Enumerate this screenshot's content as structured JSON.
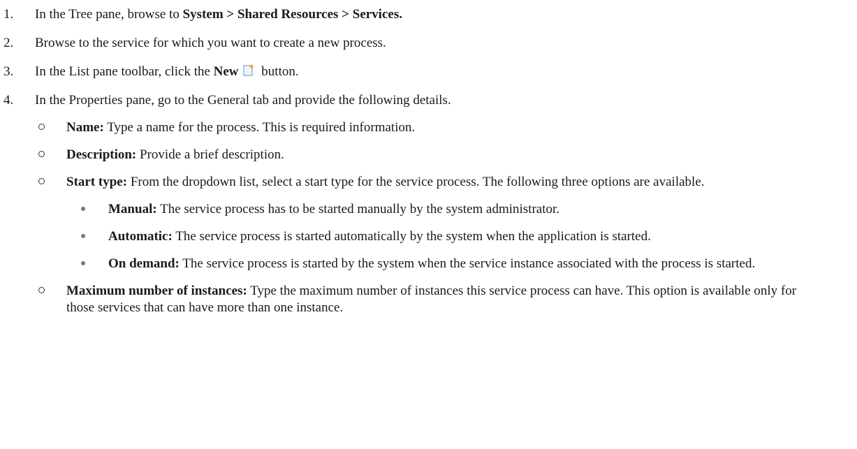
{
  "steps": [
    {
      "number": "1.",
      "text": "In the Tree pane, browse to ",
      "bold": "System > Shared Resources > Services."
    },
    {
      "number": "2.",
      "text": "Browse to the service for which you want to create a new process."
    },
    {
      "number": "3.",
      "text_before": "In the List pane toolbar, click the ",
      "bold": "New",
      "text_after": " button.",
      "icon": "new-document-icon"
    },
    {
      "number": "4.",
      "text": "In the Properties pane, go to the General tab and provide the following details."
    }
  ],
  "details": [
    {
      "term": "Name:",
      "text": " Type a name for the process. This is required information."
    },
    {
      "term": "Description:",
      "text": " Provide a brief description."
    },
    {
      "term": "Start type:",
      "text": " From the dropdown list, select a start type for the service process. The following three options are available."
    },
    {
      "term": "Maximum number of instances:",
      "text": " Type the maximum number of instances this service process can have. This option is available only for those services that can have more than one instance."
    }
  ],
  "start_types": [
    {
      "term": "Manual:",
      "text": " The service process has to be started manually by the system administrator."
    },
    {
      "term": "Automatic:",
      "text": " The service process is started automatically by the system when the application is started."
    },
    {
      "term": "On demand:",
      "text": " The service process is started by the system when the service instance associated with the process is started."
    }
  ],
  "colors": {
    "text": "#1a1a1a",
    "icon_accent": "#f5a623",
    "icon_border": "#6f9fd8"
  }
}
